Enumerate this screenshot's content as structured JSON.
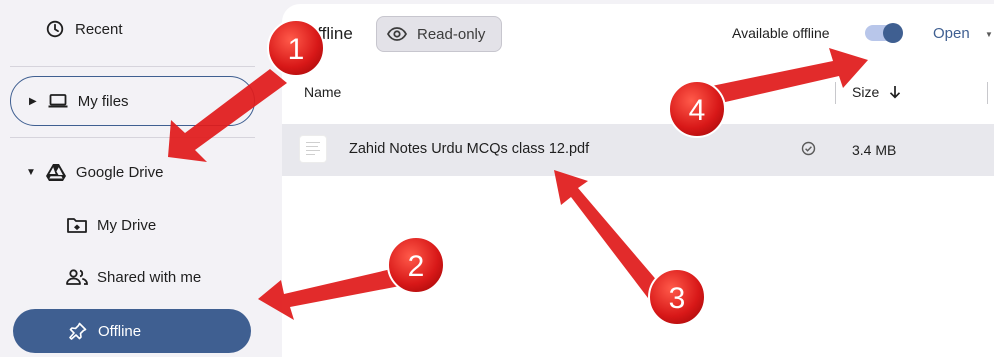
{
  "sidebar": {
    "recent": "Recent",
    "my_files": "My files",
    "google_drive": "Google Drive",
    "my_drive": "My Drive",
    "shared_with_me": "Shared with me",
    "offline": "Offline"
  },
  "header": {
    "title": "Offline",
    "read_only": "Read-only",
    "available_offline": "Available offline",
    "available_offline_on": true,
    "open": "Open"
  },
  "table": {
    "columns": {
      "name": "Name",
      "size": "Size"
    },
    "rows": [
      {
        "name": "Zahid Notes Urdu MCQs class 12.pdf",
        "size": "3.4 MB"
      }
    ]
  },
  "annotations": {
    "markers": [
      "1",
      "2",
      "3",
      "4"
    ],
    "color": "#e02020"
  },
  "colors": {
    "accent": "#3f5f91",
    "selected_row": "#e8e8ed",
    "toggle_track": "#b8c6ea"
  }
}
